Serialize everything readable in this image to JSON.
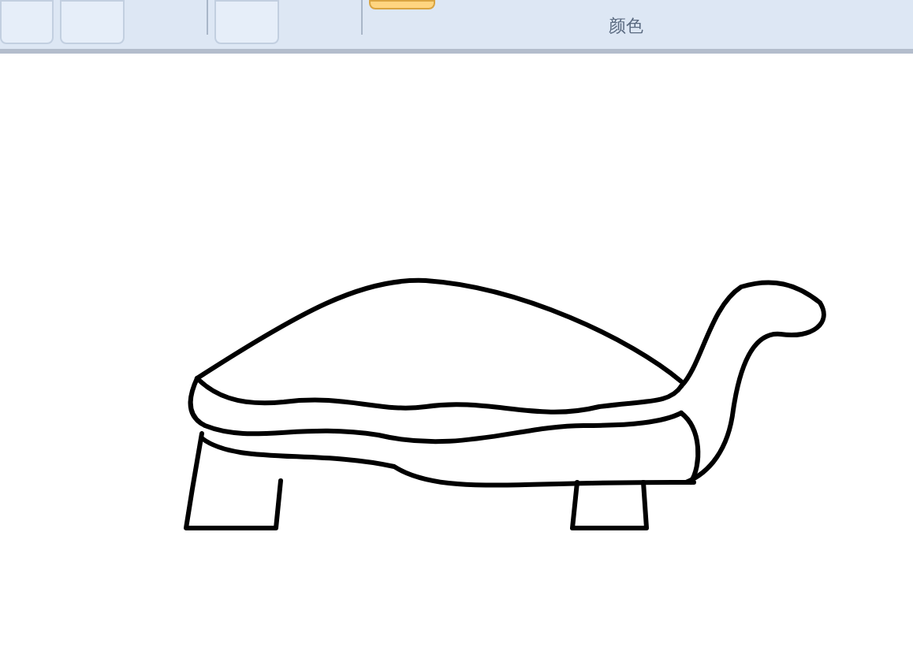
{
  "ribbon": {
    "groups": [
      {
        "label": "颜色"
      }
    ]
  }
}
